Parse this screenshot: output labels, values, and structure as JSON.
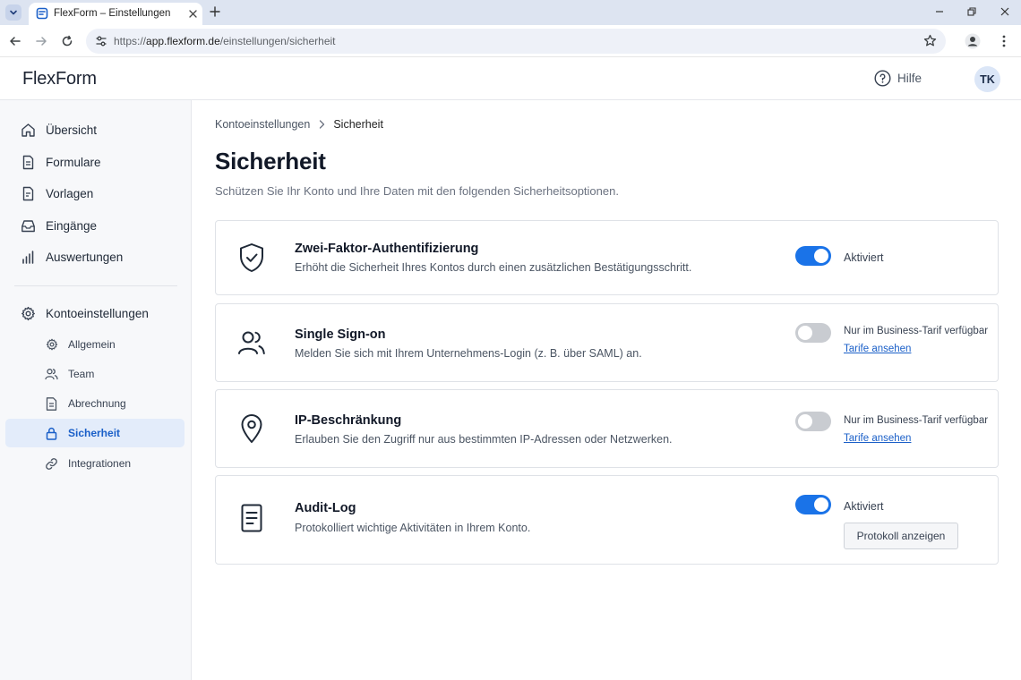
{
  "browser": {
    "tab_title": "FlexForm – Einstellungen",
    "url_scheme": "https://",
    "url_host": "app.flexform.de",
    "url_path": "/einstellungen/sicherheit"
  },
  "header": {
    "logo": "FlexForm",
    "help_label": "Hilfe",
    "avatar_initials": "TK"
  },
  "sidebar": {
    "items": [
      {
        "label": "Übersicht",
        "icon": "home-icon"
      },
      {
        "label": "Formulare",
        "icon": "form-icon"
      },
      {
        "label": "Vorlagen",
        "icon": "template-icon"
      },
      {
        "label": "Eingänge",
        "icon": "inbox-icon"
      },
      {
        "label": "Auswertungen",
        "icon": "bar-chart-icon"
      }
    ],
    "settings": {
      "label": "Kontoeinstellungen",
      "icon": "gear-icon",
      "sub_items": [
        {
          "label": "Allgemein",
          "icon": "gear-icon"
        },
        {
          "label": "Team",
          "icon": "users-icon"
        },
        {
          "label": "Abrechnung",
          "icon": "invoice-icon"
        },
        {
          "label": "Sicherheit",
          "icon": "lock-icon",
          "active": true
        },
        {
          "label": "Integrationen",
          "icon": "link-icon"
        }
      ]
    }
  },
  "main": {
    "breadcrumb": {
      "parent": "Kontoeinstellungen",
      "current": "Sicherheit"
    },
    "title": "Sicherheit",
    "subtitle": "Schützen Sie Ihr Konto und Ihre Daten mit den folgenden Sicherheitsoptionen.",
    "cards": [
      {
        "icon": "shield-check-icon",
        "title": "Zwei-Faktor-Authentifizierung",
        "description": "Erhöht die Sicherheit Ihres Kontos durch einen zusätzlichen Bestätigungsschritt.",
        "enabled": true,
        "status": "Aktiviert"
      },
      {
        "icon": "users-icon",
        "title": "Single Sign-on",
        "description": "Melden Sie sich mit Ihrem Unternehmens-Login (z. B. über SAML) an.",
        "enabled": false,
        "status": "Nur im Business-Tarif verfügbar",
        "link": "Tarife ansehen"
      },
      {
        "icon": "map-pin-icon",
        "title": "IP-Beschränkung",
        "description": "Erlauben Sie den Zugriff nur aus bestimmten IP-Adressen oder Netzwerken.",
        "enabled": false,
        "status": "Nur im Business-Tarif verfügbar",
        "link": "Tarife ansehen"
      },
      {
        "icon": "document-icon",
        "title": "Audit-Log",
        "description": "Protokolliert wichtige Aktivitäten in Ihrem Konto.",
        "enabled": true,
        "status": "Aktiviert",
        "button": "Protokoll anzeigen"
      }
    ]
  },
  "colors": {
    "accent": "#1a73e8",
    "active_nav_bg": "#e3ecfa",
    "toggle_off": "#c9ccd1"
  }
}
